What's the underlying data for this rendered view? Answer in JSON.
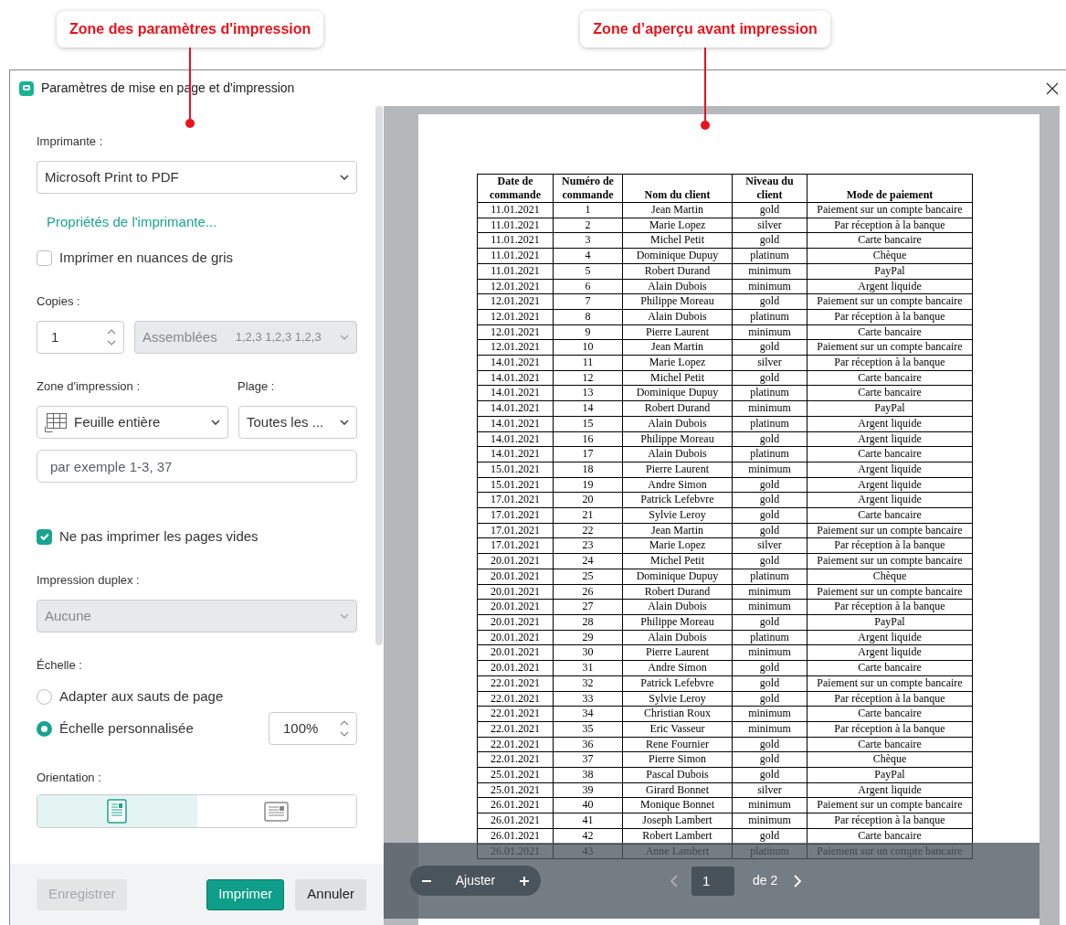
{
  "annotations": [
    {
      "text": "Zone des paramètres d'impression"
    },
    {
      "text": "Zone d’aperçu avant impression"
    }
  ],
  "window": {
    "title": "Paramètres de mise en page et d'impression"
  },
  "settings": {
    "printer": {
      "label": "Imprimante :",
      "value": "Microsoft Print to PDF"
    },
    "printer_properties_link": "Propriétés de l'imprimante...",
    "grayscale": {
      "label": "Imprimer en nuances de gris",
      "checked": false
    },
    "copies": {
      "label": "Copies :",
      "value": "1"
    },
    "collate": {
      "value": "Assemblées",
      "hint": "1,2,3 1,2,3 1,2,3",
      "disabled": true
    },
    "print_area": {
      "label": "Zone d'impression :",
      "value": "Feuille entière"
    },
    "range": {
      "label": "Plage :",
      "value": "Toutes les ..."
    },
    "pages_field": {
      "placeholder": "par exemple 1-3, 37"
    },
    "skip_blank": {
      "label": "Ne pas imprimer les pages vides",
      "checked": true
    },
    "duplex": {
      "label": "Impression duplex :",
      "value": "Aucune",
      "disabled": true
    },
    "scale": {
      "label": "Échelle :",
      "value": "100%",
      "options": [
        {
          "label": "Adapter aux sauts de page",
          "selected": false
        },
        {
          "label": "Échelle personnalisée",
          "selected": true
        }
      ]
    },
    "orientation": {
      "label": "Orientation :",
      "options": [
        {
          "kind": "portrait",
          "selected": true
        },
        {
          "kind": "landscape",
          "selected": false
        }
      ]
    }
  },
  "buttons": [
    {
      "label": "Enregistrer",
      "kind": "secondary",
      "disabled": true
    },
    {
      "label": "Imprimer",
      "kind": "primary",
      "disabled": false
    },
    {
      "label": "Annuler",
      "kind": "secondary",
      "disabled": false
    }
  ],
  "preview": {
    "table": {
      "columns": [
        "Date de commande",
        "Numéro de commande",
        "Nom du client",
        "Niveau du client",
        "Mode de paiement"
      ],
      "rows": [
        [
          "11.01.2021",
          "1",
          "Jean Martin",
          "gold",
          "Paiement sur un compte bancaire"
        ],
        [
          "11.01.2021",
          "2",
          "Marie Lopez",
          "silver",
          "Par réception à la banque"
        ],
        [
          "11.01.2021",
          "3",
          "Michel Petit",
          "gold",
          "Carte bancaire"
        ],
        [
          "11.01.2021",
          "4",
          "Dominique Dupuy",
          "platinum",
          "Chèque"
        ],
        [
          "11.01.2021",
          "5",
          "Robert Durand",
          "minimum",
          "PayPal"
        ],
        [
          "12.01.2021",
          "6",
          "Alain Dubois",
          "minimum",
          "Argent liquide"
        ],
        [
          "12.01.2021",
          "7",
          "Philippe Moreau",
          "gold",
          "Paiement sur un compte bancaire"
        ],
        [
          "12.01.2021",
          "8",
          "Alain Dubois",
          "platinum",
          "Par réception à la banque"
        ],
        [
          "12.01.2021",
          "9",
          "Pierre Laurent",
          "minimum",
          "Carte bancaire"
        ],
        [
          "12.01.2021",
          "10",
          "Jean Martin",
          "gold",
          "Paiement sur un compte bancaire"
        ],
        [
          "14.01.2021",
          "11",
          "Marie Lopez",
          "silver",
          "Par réception à la banque"
        ],
        [
          "14.01.2021",
          "12",
          "Michel Petit",
          "gold",
          "Carte bancaire"
        ],
        [
          "14.01.2021",
          "13",
          "Dominique Dupuy",
          "platinum",
          "Carte bancaire"
        ],
        [
          "14.01.2021",
          "14",
          "Robert Durand",
          "minimum",
          "PayPal"
        ],
        [
          "14.01.2021",
          "15",
          "Alain Dubois",
          "platinum",
          "Argent liquide"
        ],
        [
          "14.01.2021",
          "16",
          "Philippe Moreau",
          "gold",
          "Argent liquide"
        ],
        [
          "14.01.2021",
          "17",
          "Alain Dubois",
          "platinum",
          "Carte bancaire"
        ],
        [
          "15.01.2021",
          "18",
          "Pierre Laurent",
          "minimum",
          "Argent liquide"
        ],
        [
          "15.01.2021",
          "19",
          "Andre Simon",
          "gold",
          "Argent liquide"
        ],
        [
          "17.01.2021",
          "20",
          "Patrick Lefebvre",
          "gold",
          "Argent liquide"
        ],
        [
          "17.01.2021",
          "21",
          "Sylvie Leroy",
          "gold",
          "Carte bancaire"
        ],
        [
          "17.01.2021",
          "22",
          "Jean Martin",
          "gold",
          "Paiement sur un compte bancaire"
        ],
        [
          "17.01.2021",
          "23",
          "Marie Lopez",
          "silver",
          "Par réception à la banque"
        ],
        [
          "20.01.2021",
          "24",
          "Michel Petit",
          "gold",
          "Paiement sur un compte bancaire"
        ],
        [
          "20.01.2021",
          "25",
          "Dominique Dupuy",
          "platinum",
          "Chèque"
        ],
        [
          "20.01.2021",
          "26",
          "Robert Durand",
          "minimum",
          "Paiement sur un compte bancaire"
        ],
        [
          "20.01.2021",
          "27",
          "Alain Dubois",
          "minimum",
          "Par réception à la banque"
        ],
        [
          "20.01.2021",
          "28",
          "Philippe Moreau",
          "gold",
          "PayPal"
        ],
        [
          "20.01.2021",
          "29",
          "Alain Dubois",
          "platinum",
          "Argent liquide"
        ],
        [
          "20.01.2021",
          "30",
          "Pierre Laurent",
          "minimum",
          "Argent liquide"
        ],
        [
          "20.01.2021",
          "31",
          "Andre Simon",
          "gold",
          "Carte bancaire"
        ],
        [
          "22.01.2021",
          "32",
          "Patrick Lefebvre",
          "gold",
          "Paiement sur un compte bancaire"
        ],
        [
          "22.01.2021",
          "33",
          "Sylvie Leroy",
          "gold",
          "Par réception à la banque"
        ],
        [
          "22.01.2021",
          "34",
          "Christian Roux",
          "minimum",
          "Carte bancaire"
        ],
        [
          "22.01.2021",
          "35",
          "Eric Vasseur",
          "minimum",
          "Par réception à la banque"
        ],
        [
          "22.01.2021",
          "36",
          "Rene Fournier",
          "gold",
          "Carte bancaire"
        ],
        [
          "22.01.2021",
          "37",
          "Pierre Simon",
          "gold",
          "Chèque"
        ],
        [
          "25.01.2021",
          "38",
          "Pascal Dubois",
          "gold",
          "PayPal"
        ],
        [
          "25.01.2021",
          "39",
          "Girard Bonnet",
          "silver",
          "Argent liquide"
        ],
        [
          "26.01.2021",
          "40",
          "Monique Bonnet",
          "minimum",
          "Paiement sur un compte bancaire"
        ],
        [
          "26.01.2021",
          "41",
          "Joseph Lambert",
          "minimum",
          "Par réception à la banque"
        ],
        [
          "26.01.2021",
          "42",
          "Robert Lambert",
          "gold",
          "Carte bancaire"
        ],
        [
          "26.01.2021",
          "43",
          "Anne Lambert",
          "platinum",
          "Paiement sur un compte bancaire"
        ]
      ]
    },
    "toolbar": {
      "zoom_label": "Ajuster",
      "page": "1",
      "page_total": "de 2"
    }
  }
}
